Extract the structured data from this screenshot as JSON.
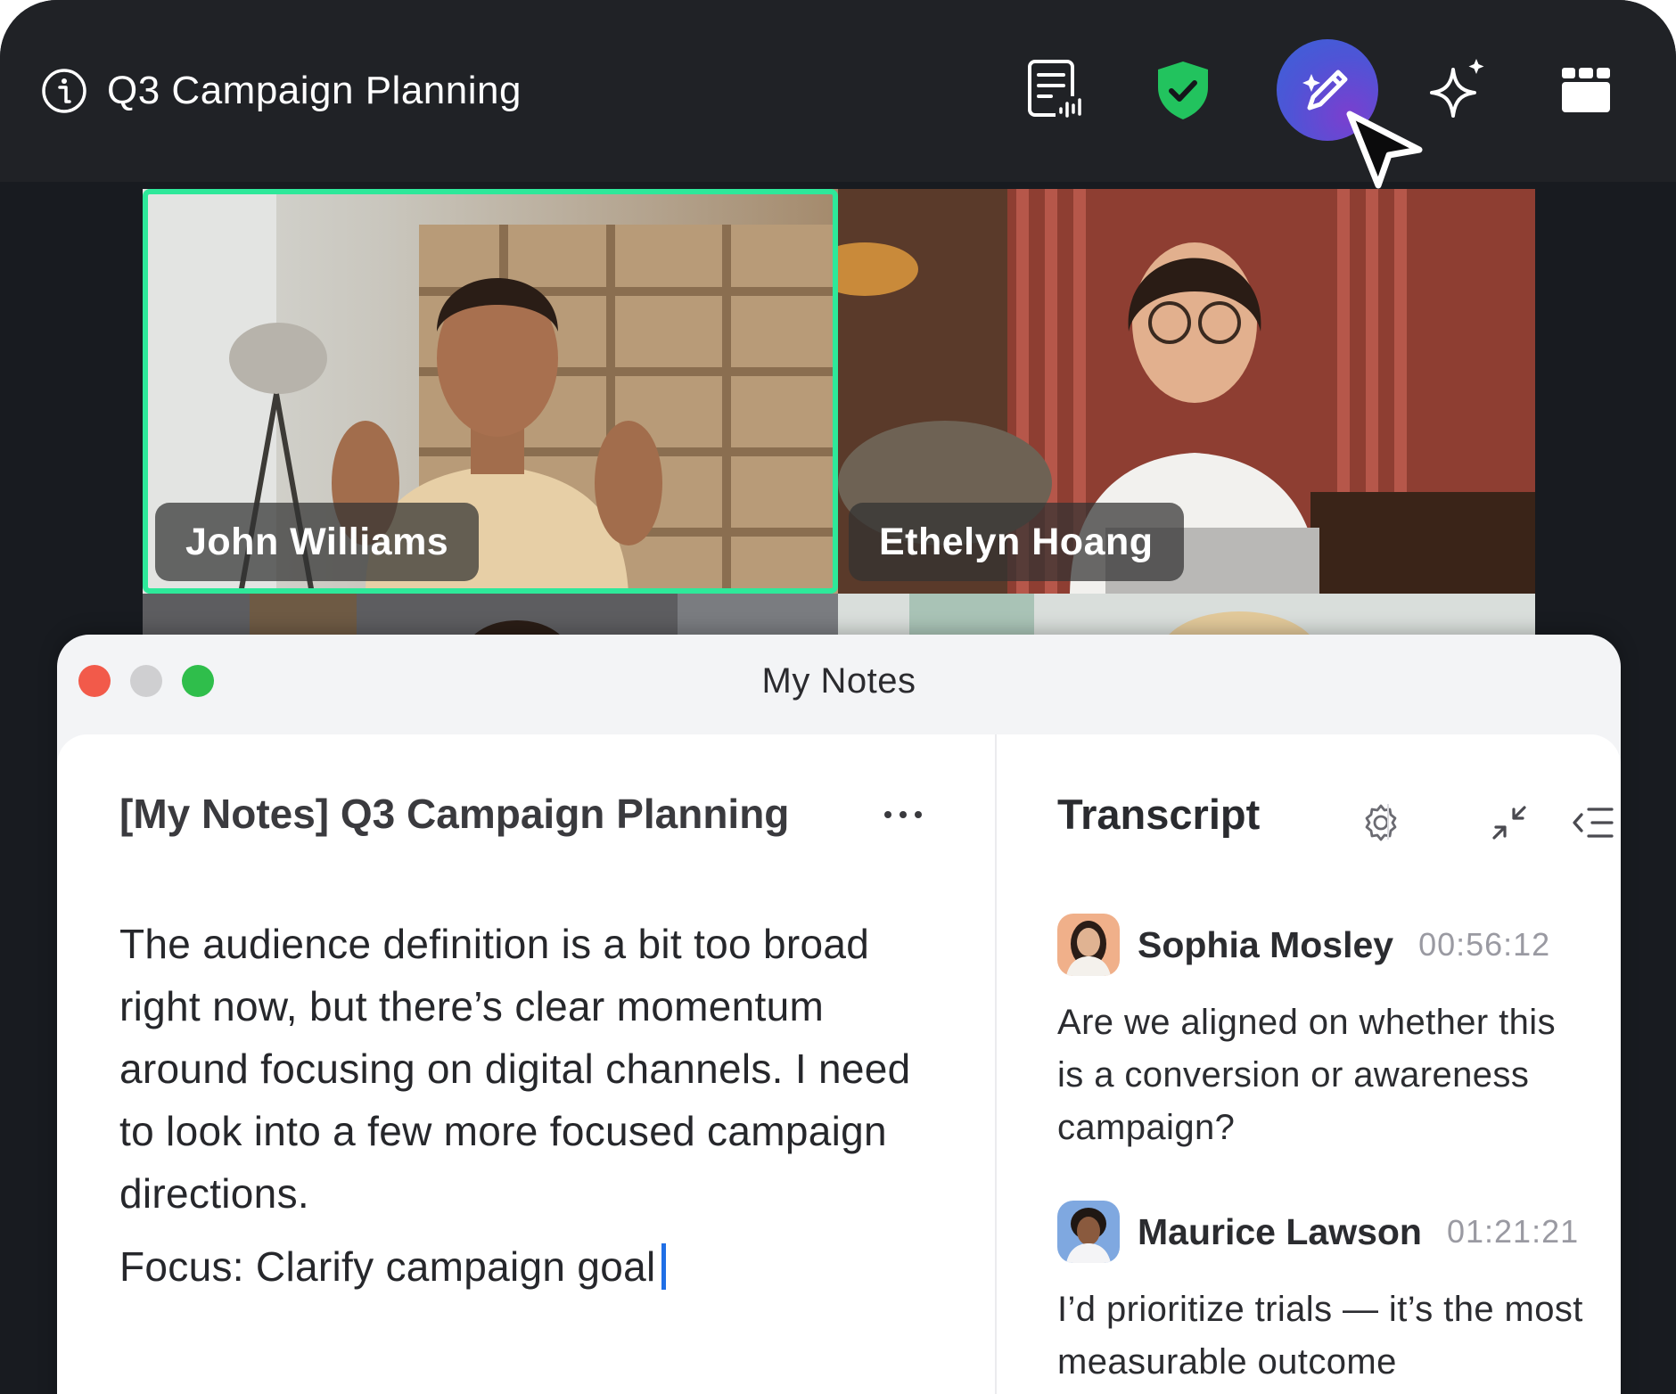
{
  "meeting": {
    "title": "Q3 Campaign Planning",
    "info_icon": "info-icon"
  },
  "toolbar": {
    "icons": [
      "transcript-doc-icon",
      "shield-check-icon",
      "ai-notes-pen-icon",
      "sparkle-icon",
      "grid-view-icon"
    ],
    "active": "ai-notes-pen-icon"
  },
  "participants": [
    {
      "name": "John Williams",
      "active_speaker": true
    },
    {
      "name": "Ethelyn Hoang",
      "active_speaker": false
    }
  ],
  "notes_window": {
    "title": "My Notes",
    "document": {
      "title": "[My Notes] Q3 Campaign Planning",
      "body": "The audience definition is a bit too broad right now, but there’s clear momentum around focusing on digital channels. I need to look into a few more focused campaign directions.",
      "focus_line": "Focus: Clarify campaign goal"
    },
    "transcript": {
      "title": "Transcript",
      "entries": [
        {
          "speaker": "Sophia Mosley",
          "time": "00:56:12",
          "text": "Are we aligned on whether this is a conversion or awareness campaign?"
        },
        {
          "speaker": "Maurice Lawson",
          "time": "01:21:21",
          "text": "I’d prioritize trials — it’s the most measurable outcome"
        }
      ]
    }
  },
  "colors": {
    "active_speaker_border": "#2ee89a",
    "shield": "#22c35e",
    "ai_button_gradient": [
      "#3a63d8",
      "#7a3fcf"
    ],
    "caret": "#1f6fe6"
  }
}
